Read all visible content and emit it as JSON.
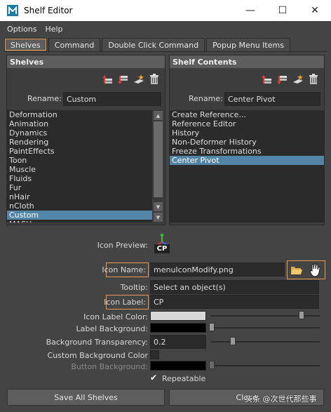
{
  "window": {
    "title": "Shelf Editor",
    "minimize": "—",
    "maximize": "☐",
    "close": "✕"
  },
  "menu": {
    "options": "Options",
    "help": "Help"
  },
  "tabs": [
    {
      "label": "Shelves"
    },
    {
      "label": "Command"
    },
    {
      "label": "Double Click Command"
    },
    {
      "label": "Popup Menu Items"
    }
  ],
  "shelves_panel": {
    "header": "Shelves",
    "rename_label": "Rename:",
    "rename_value": "Custom",
    "items": [
      "Deformation",
      "Animation",
      "Dynamics",
      "Rendering",
      "PaintEffects",
      "Toon",
      "Muscle",
      "Fluids",
      "Fur",
      "nHair",
      "nCloth",
      "Custom",
      "MASH"
    ],
    "selected_index": 11
  },
  "contents_panel": {
    "header": "Shelf Contents",
    "rename_label": "Rename:",
    "rename_value": "Center Pivot",
    "items": [
      "Create Reference...",
      "Reference Editor",
      "History",
      "Non-Deformer History",
      "Freeze Transformations",
      "Center Pivot"
    ],
    "selected_index": 5
  },
  "details": {
    "icon_preview_label": "Icon Preview:",
    "icon_preview_text": "CP",
    "icon_name_label": "Icon Name:",
    "icon_name_value": "menuIconModify.png",
    "tooltip_label": "Tooltip:",
    "tooltip_value": "Select an object(s)",
    "icon_label_label": "Icon Label:",
    "icon_label_value": "CP",
    "icon_label_color_label": "Icon Label Color:",
    "label_background_label": "Label Background:",
    "background_transparency_label": "Background Transparency:",
    "background_transparency_value": "0.2",
    "custom_background_color_label": "Custom Background Color",
    "button_background_label": "Button Background:",
    "repeatable_label": "Repeatable",
    "repeatable_checked": "✔",
    "icon_label_color": "#d8d8d8",
    "label_background_color": "#000000",
    "button_background_color": "#000000",
    "icon_label_color_level": 0.85,
    "label_background_level": 0.0,
    "transparency_level": 0.2,
    "button_background_level": 0.0
  },
  "footer": {
    "save_all": "Save All Shelves",
    "close": "Close"
  },
  "watermark": "头条 @次世代那些事",
  "colors": {
    "accent": "#e89a53",
    "selection": "#5285a6"
  }
}
